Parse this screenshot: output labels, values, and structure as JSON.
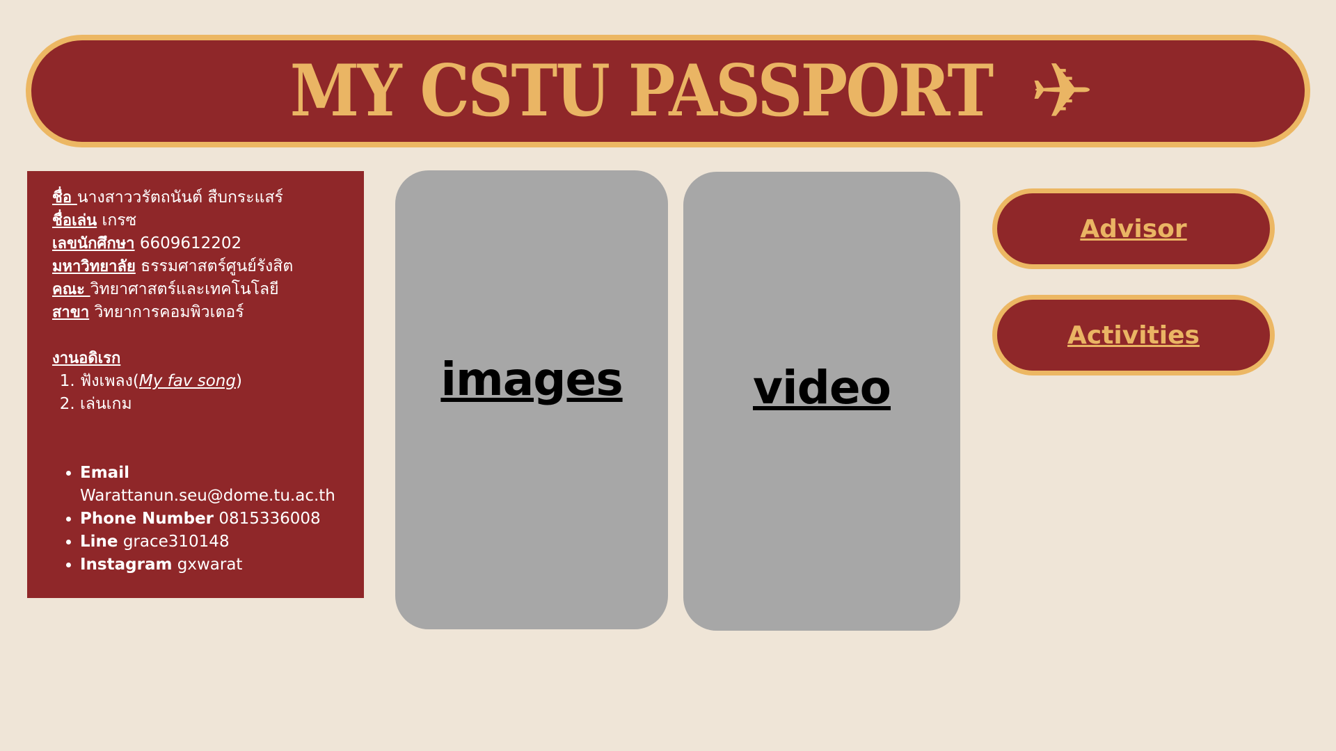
{
  "header": {
    "title": "MY CSTU PASSPORT",
    "icon": "airplane-icon",
    "icon_glyph": "✈"
  },
  "profile": {
    "fields": [
      {
        "label": "ชื่อ ",
        "value": "นางสาววรัตถนันต์ สืบกระแสร์"
      },
      {
        "label": "ชื่อเล่น",
        "value": " เกรซ"
      },
      {
        "label": "เลขนักศึกษา",
        "value": " 6609612202"
      },
      {
        "label": "มหาวิทยาลัย",
        "value": " ธรรมศาสตร์ศูนย์รังสิต"
      },
      {
        "label": "คณะ ",
        "value": "วิทยาศาสตร์และเทคโนโลยี"
      },
      {
        "label": "สาขา",
        "value": " วิทยาการคอมพิวเตอร์"
      }
    ],
    "hobbies_title": "งานอดิเรก",
    "hobbies": [
      {
        "prefix": "ฟังเพลง(",
        "link": "My fav song",
        "suffix": ")"
      },
      {
        "text": "เล่นเกม"
      }
    ],
    "contacts": [
      {
        "key": "Email",
        "value": "Warattanun.seu@dome.tu.ac.th"
      },
      {
        "key": "Phone Number",
        "value": " 0815336008"
      },
      {
        "key": "Line",
        "value": " grace310148"
      },
      {
        "key": "Instagram",
        "value": " gxwarat"
      }
    ]
  },
  "media": {
    "images_label": "images",
    "video_label": "video"
  },
  "nav": {
    "advisor_label": "Advisor",
    "activities_label": "Activities"
  },
  "colors": {
    "background": "#efe5d7",
    "maroon": "#8f2729",
    "gold": "#eab564",
    "card_gray": "#a7a7a7"
  }
}
